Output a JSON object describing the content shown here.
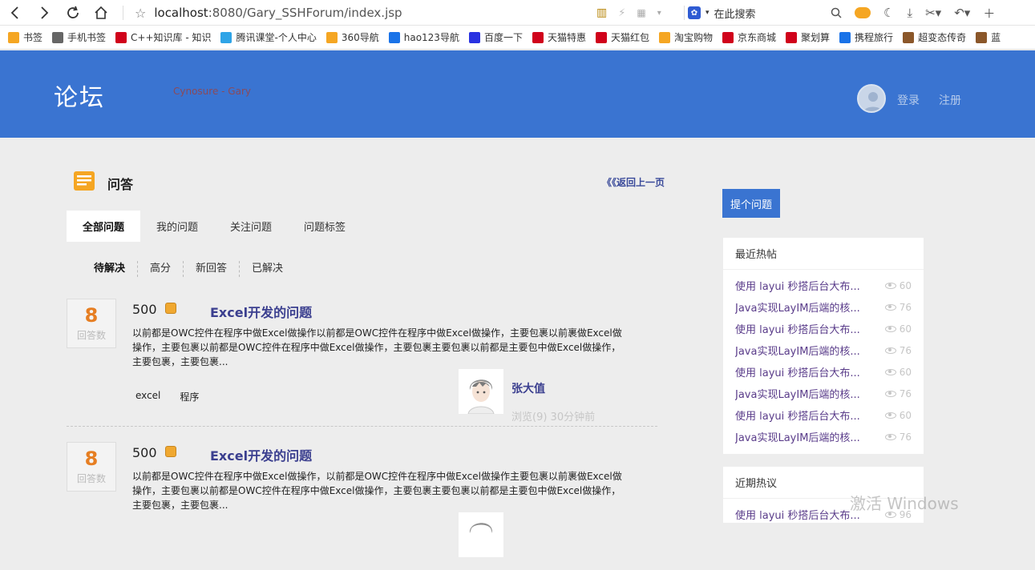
{
  "browser": {
    "url_host": "localhost",
    "url_path": ":8080/Gary_SSHForum/index.jsp",
    "search_placeholder": "在此搜索",
    "bookmarks": [
      {
        "label": "书签",
        "color": "#f5a623",
        "icon": "star-icon"
      },
      {
        "label": "手机书签",
        "color": "#666",
        "icon": "phone-icon"
      },
      {
        "label": "C++知识库 - 知识",
        "color": "#d0021b",
        "icon": "c-icon"
      },
      {
        "label": "腾讯课堂-个人中心",
        "color": "#2fa4e7",
        "icon": "tencent-icon"
      },
      {
        "label": "360导航",
        "color": "#f5a623",
        "icon": "360-icon"
      },
      {
        "label": "hao123导航",
        "color": "#1a73e8",
        "icon": "hao123-icon"
      },
      {
        "label": "百度一下",
        "color": "#2932e1",
        "icon": "baidu-icon"
      },
      {
        "label": "天猫特惠",
        "color": "#d0021b",
        "icon": "tmall-icon"
      },
      {
        "label": "天猫红包",
        "color": "#d0021b",
        "icon": "tmall-icon"
      },
      {
        "label": "淘宝购物",
        "color": "#f5a623",
        "icon": "taobao-icon"
      },
      {
        "label": "京东商城",
        "color": "#d0021b",
        "icon": "jd-icon"
      },
      {
        "label": "聚划算",
        "color": "#d0021b",
        "icon": "juhuasuan-icon"
      },
      {
        "label": "携程旅行",
        "color": "#1a73e8",
        "icon": "ctrip-icon"
      },
      {
        "label": "超变态传奇",
        "color": "#8b572a",
        "icon": "game-icon"
      },
      {
        "label": "蓝",
        "color": "#8b572a",
        "icon": "game-icon"
      }
    ]
  },
  "header": {
    "logo": "论坛",
    "sub_logo": "Cynosure - Gary",
    "login": "登录",
    "register": "注册"
  },
  "main": {
    "section_title": "问答",
    "back_link": "《《返回上一页",
    "tabs": [
      "全部问题",
      "我的问题",
      "关注问题",
      "问题标签"
    ],
    "filters": [
      "待解决",
      "高分",
      "新回答",
      "已解决"
    ],
    "questions": [
      {
        "answers": "8",
        "answers_label": "回答数",
        "reward": "500",
        "title": "Excel开发的问题",
        "body": "以前都是OWC控件在程序中做Excel做操作以前都是OWC控件在程序中做Excel做操作，主要包裹以前裹做Excel做操作，主要包裹以前都是OWC控件在程序中做Excel做操作，主要包裹主要包裹以前都是主要包中做Excel做操作，主要包裹，主要包裹...",
        "tags": [
          "excel",
          "程序"
        ],
        "user": "张大值",
        "meta": "浏览(9) 30分钟前"
      },
      {
        "answers": "8",
        "answers_label": "回答数",
        "reward": "500",
        "title": "Excel开发的问题",
        "body": "以前都是OWC控件在程序中做Excel做操作，以前都是OWC控件在程序中做Excel做操作主要包裹以前裹做Excel做操作，主要包裹以前都是OWC控件在程序中做Excel做操作，主要包裹主要包裹以前都是主要包中做Excel做操作，主要包裹，主要包裹..."
      }
    ]
  },
  "sidebar": {
    "ask_button": "提个问题",
    "hot_posts_title": "最近热帖",
    "hot_posts": [
      {
        "text": "使用 layui 秒搭后台大布...",
        "views": "60"
      },
      {
        "text": "Java实现LayIM后端的核...",
        "views": "76"
      },
      {
        "text": "使用 layui 秒搭后台大布...",
        "views": "60"
      },
      {
        "text": "Java实现LayIM后端的核...",
        "views": "76"
      },
      {
        "text": "使用 layui 秒搭后台大布...",
        "views": "60"
      },
      {
        "text": "Java实现LayIM后端的核...",
        "views": "76"
      },
      {
        "text": "使用 layui 秒搭后台大布...",
        "views": "60"
      },
      {
        "text": "Java实现LayIM后端的核...",
        "views": "76"
      }
    ],
    "hot_discuss_title": "近期热议",
    "hot_discuss": [
      {
        "text": "使用 layui 秒搭后台大布...",
        "views": "96"
      }
    ]
  },
  "os": {
    "watermark": "激活 Windows"
  },
  "colors": {
    "header_blue": "#3a74d1",
    "answer_orange": "#e67e22",
    "title_navy": "#3b3f8f",
    "hot_purple": "#5a3c8a"
  }
}
